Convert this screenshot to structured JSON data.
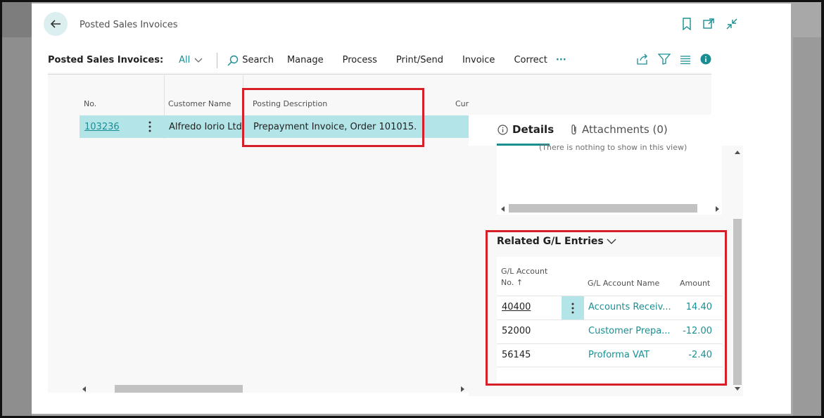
{
  "window": {
    "title": "Posted Sales Invoices"
  },
  "actionbar": {
    "caption": "Posted Sales Invoices:",
    "view": "All",
    "items": [
      "Search",
      "Manage",
      "Process",
      "Print/Send",
      "Invoice",
      "Correct"
    ],
    "more": "···"
  },
  "list": {
    "columns": [
      "No.",
      "Customer Name",
      "Posting Description",
      "Cur"
    ],
    "rows": [
      {
        "no": "103236",
        "customer": "Alfredo Iorio Ltd",
        "description": "Prepayment Invoice, Order 101015."
      }
    ]
  },
  "factbox": {
    "tabs": [
      {
        "label": "Details",
        "active": true
      },
      {
        "label": "Attachments (0)",
        "active": false
      }
    ],
    "empty_message": "(There is nothing to show in this view)",
    "gl_section": {
      "title": "Related G/L Entries",
      "headers": {
        "account_no_line1": "G/L Account",
        "account_no_line2": "No. ↑",
        "account_name": "G/L Account Name",
        "amount": "Amount"
      },
      "rows": [
        {
          "account": "40400",
          "name": "Accounts Receiv...",
          "amount": "14.40"
        },
        {
          "account": "52000",
          "name": "Customer Prepa...",
          "amount": "-12.00"
        },
        {
          "account": "56145",
          "name": "Proforma VAT",
          "amount": "-2.40"
        }
      ]
    }
  },
  "colors": {
    "accent": "#1a8f93",
    "selected_row": "#b3e5e8",
    "highlight": "#d71f2a"
  }
}
